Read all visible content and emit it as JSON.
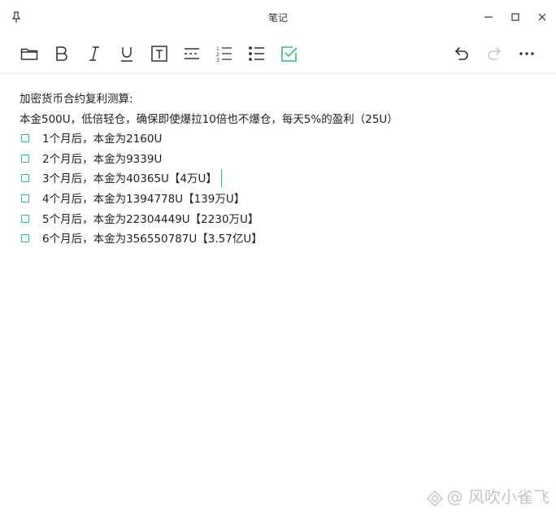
{
  "window": {
    "title": "笔记"
  },
  "colors": {
    "accent": "#2fbf78",
    "icon": "#333333",
    "disabled_icon": "#c8c8c8"
  },
  "toolbar": {
    "left_icons": [
      "folder-icon",
      "bold-icon",
      "italic-icon",
      "underline-icon",
      "text-box-icon",
      "divider-line-icon",
      "numbered-list-icon",
      "bullet-list-icon",
      "checklist-icon"
    ],
    "right_icons": [
      "undo-icon",
      "redo-icon",
      "more-icon"
    ]
  },
  "note": {
    "heading": "加密货币合约复利测算:",
    "intro": "本金500U，低倍轻仓，确保即使爆拉10倍也不爆仓，每天5%的盈利（25U）",
    "items": [
      {
        "text": "1个月后，本金为2160U",
        "checked": false
      },
      {
        "text": "2个月后，本金为9339U",
        "checked": false
      },
      {
        "text": "3个月后，本金为40365U【4万U】",
        "checked": false
      },
      {
        "text": "4个月后，本金为1394778U【139万U】",
        "checked": false
      },
      {
        "text": "5个月后，本金为22304449U【2230万U】",
        "checked": false
      },
      {
        "text": "6个月后，本金为356550787U【3.57亿U】",
        "checked": false
      }
    ]
  },
  "watermark": {
    "text": "@ 风吹小雀飞"
  }
}
